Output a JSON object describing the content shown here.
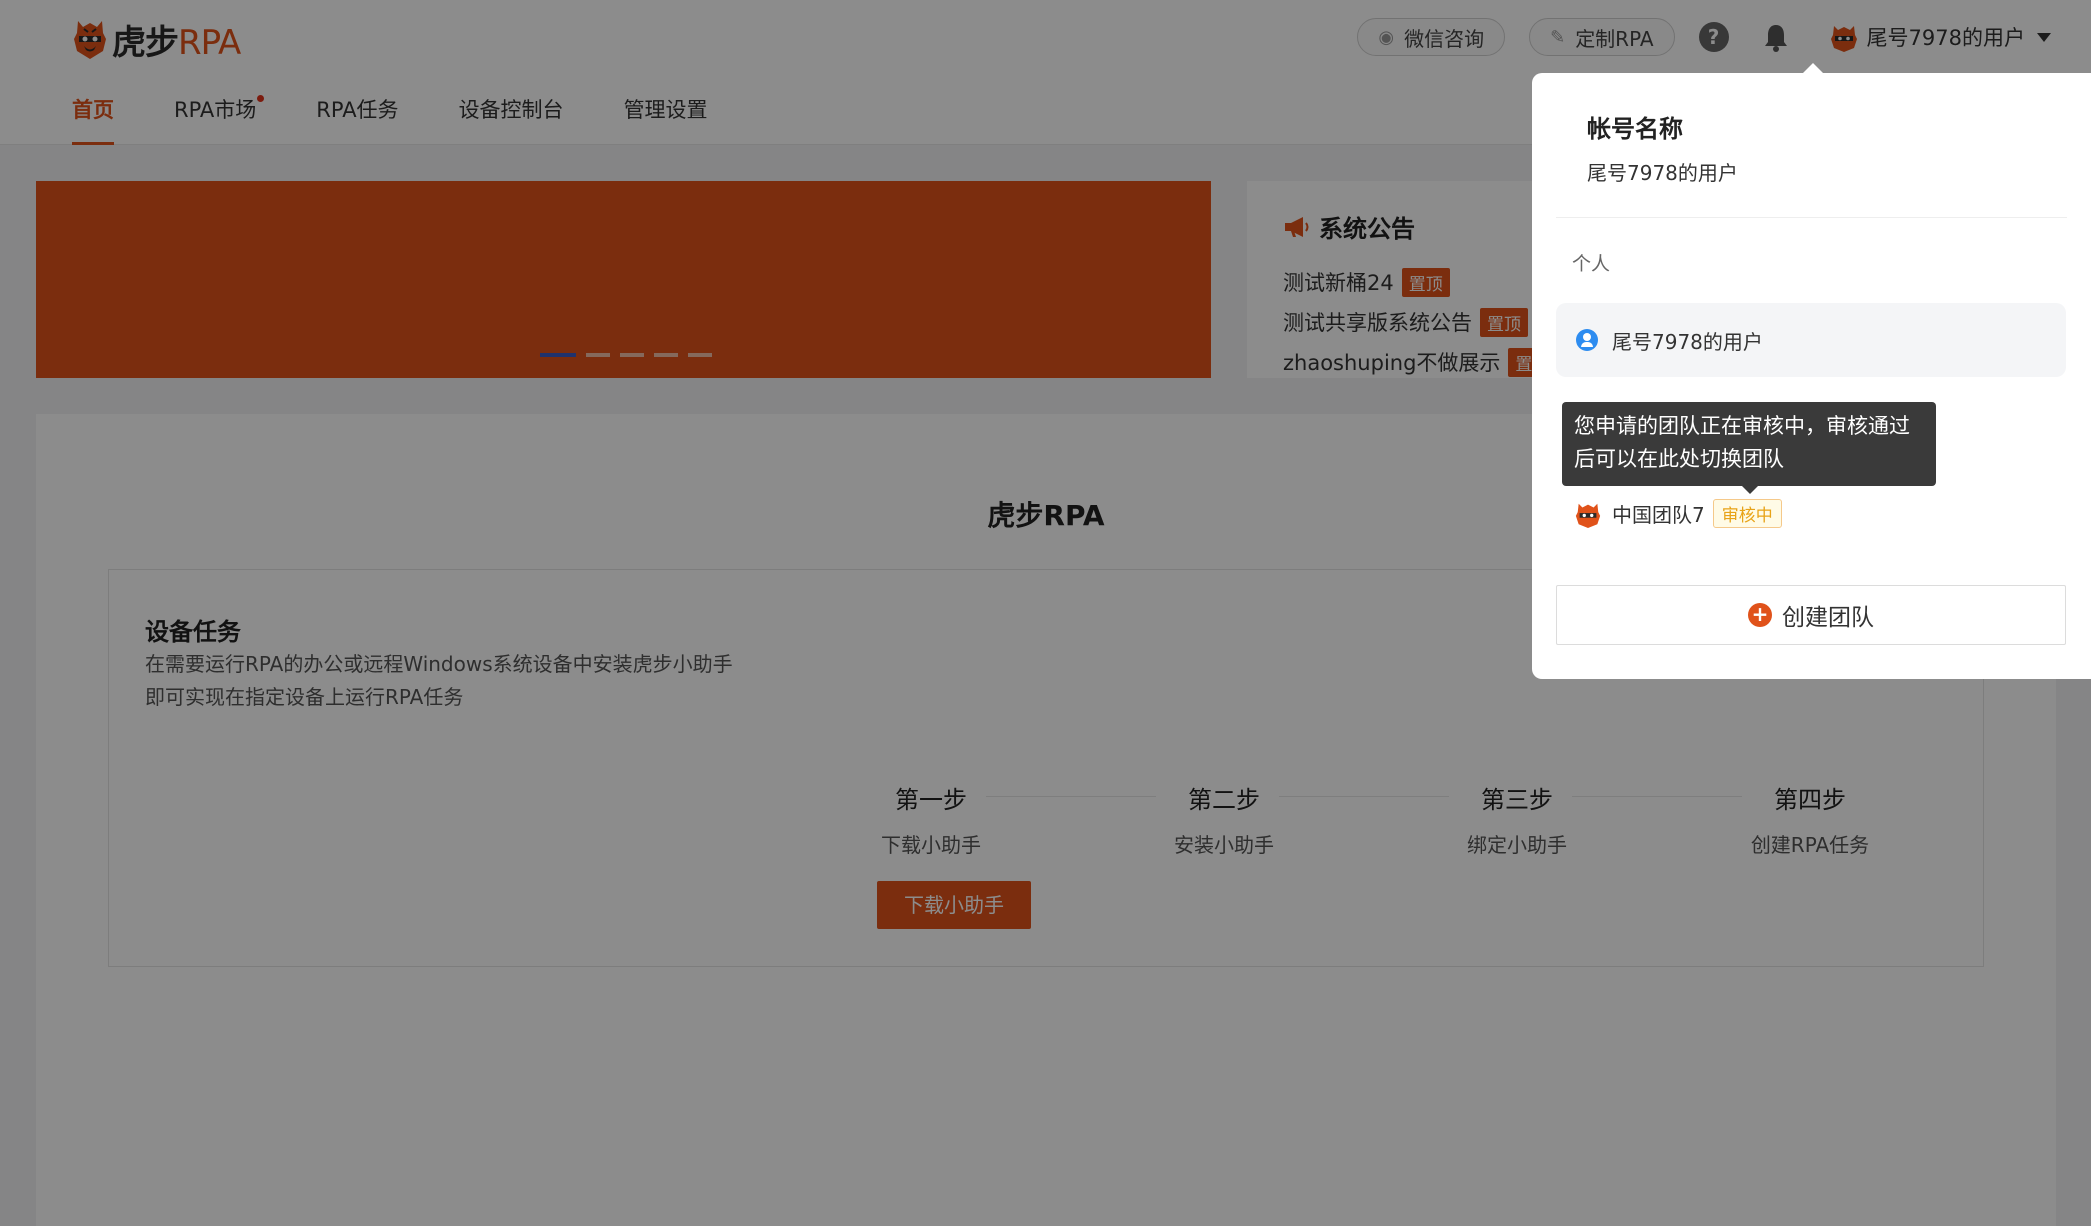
{
  "header": {
    "brand_cn": "虎步",
    "brand_en": "RPA",
    "nav": [
      "首页",
      "RPA市场",
      "RPA任务",
      "设备控制台",
      "管理设置"
    ],
    "wechat_label": "微信咨询",
    "custom_label": "定制RPA",
    "help_glyph": "?",
    "user_name": "尾号7978的用户"
  },
  "banner": {
    "slides": 5,
    "active_slide": 1
  },
  "notice": {
    "title": "系统公告",
    "items": [
      {
        "text": "测试新桶24",
        "tag": "置顶"
      },
      {
        "text": "测试共享版系统公告",
        "tag": "置顶"
      },
      {
        "text": "zhaoshuping不做展示",
        "tag": "置顶"
      }
    ]
  },
  "main": {
    "title": "虎步RPA",
    "card_title": "设备任务",
    "card_desc_1": "在需要运行RPA的办公或远程Windows系统设备中安装虎步小助手",
    "card_desc_2": "即可实现在指定设备上运行RPA任务",
    "steps": [
      {
        "name": "第一步",
        "desc": "下载小助手"
      },
      {
        "name": "第二步",
        "desc": "安装小助手"
      },
      {
        "name": "第三步",
        "desc": "绑定小助手"
      },
      {
        "name": "第四步",
        "desc": "创建RPA任务"
      }
    ],
    "download_button": "下载小助手"
  },
  "dropdown": {
    "account_label": "帐号名称",
    "account_name": "尾号7978的用户",
    "personal_section": "个人",
    "personal_user": "尾号7978的用户",
    "tooltip": "您申请的团队正在审核中，审核通过后可以在此处切换团队",
    "team_name": "中国团队7",
    "team_status": "审核中",
    "create_team_label": "创建团队"
  },
  "colors": {
    "brand": "#e0521a",
    "active_dot": "#3a5bc7",
    "user_icon": "#2d8cf0"
  }
}
